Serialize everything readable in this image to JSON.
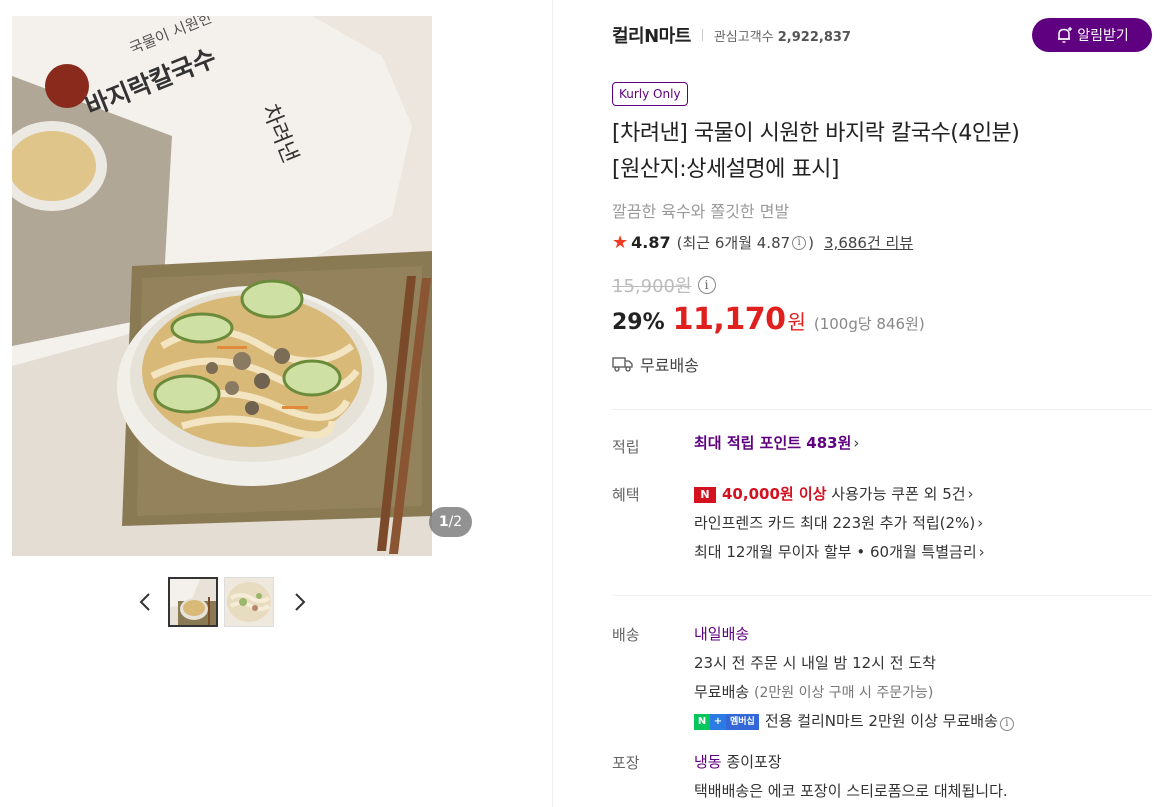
{
  "gallery": {
    "counter_current": "1",
    "counter_total": "/2",
    "package_text_small": "국물이 시원한",
    "package_text_large": "바지락칼국수",
    "package_brand": "차려낸"
  },
  "store": {
    "name": "컬리N마트",
    "fans_label": "관심고객수",
    "fans_count": "2,922,837",
    "notify_label": "알림받기"
  },
  "product": {
    "badge": "Kurly Only",
    "title_line1": "[차려낸] 국물이 시원한 바지락 칼국수(4인분)",
    "title_line2": "[원산지:상세설명에 표시]",
    "subtitle": "깔끔한 육수와 쫄깃한 면발",
    "rating": "4.87",
    "recent_rating": "(최근 6개월 4.87",
    "recent_close": ")",
    "reviews": "3,686건 리뷰",
    "original_price": "15,900원",
    "discount": "29%",
    "sale_price": "11,170",
    "won": "원",
    "unit_price": "(100g당 846원)",
    "shipping": "무료배송"
  },
  "points": {
    "label": "적립",
    "text": "최대 적립 포인트 483원"
  },
  "benefits": {
    "label": "혜택",
    "nbadge": "N",
    "coupon_amount": "40,000원 이상",
    "coupon_text": "사용가능 쿠폰 외 5건",
    "card": "라인프렌즈 카드 최대 223원 추가 적립(2%)",
    "installment": "최대 12개월 무이자 할부 • 60개월 특별금리"
  },
  "delivery": {
    "label": "배송",
    "type": "내일배송",
    "arrival": "23시 전 주문 시 내일 밤 12시 전 도착",
    "free": "무료배송",
    "free_note": "(2만원 이상 구매 시 주문가능)",
    "membership_n": "N",
    "membership_plus": "+",
    "membership_tag": "멤버십",
    "membership_text": "전용 컬리N마트 2만원 이상 무료배송"
  },
  "packaging": {
    "label": "포장",
    "type": "냉동",
    "type_rest": "종이포장",
    "note": "택배배송은 에코 포장이 스티로폼으로 대체됩니다."
  },
  "colors": {
    "brand_purple": "#5f0080",
    "sale_red": "#e01f1f",
    "star": "#f03a24"
  }
}
